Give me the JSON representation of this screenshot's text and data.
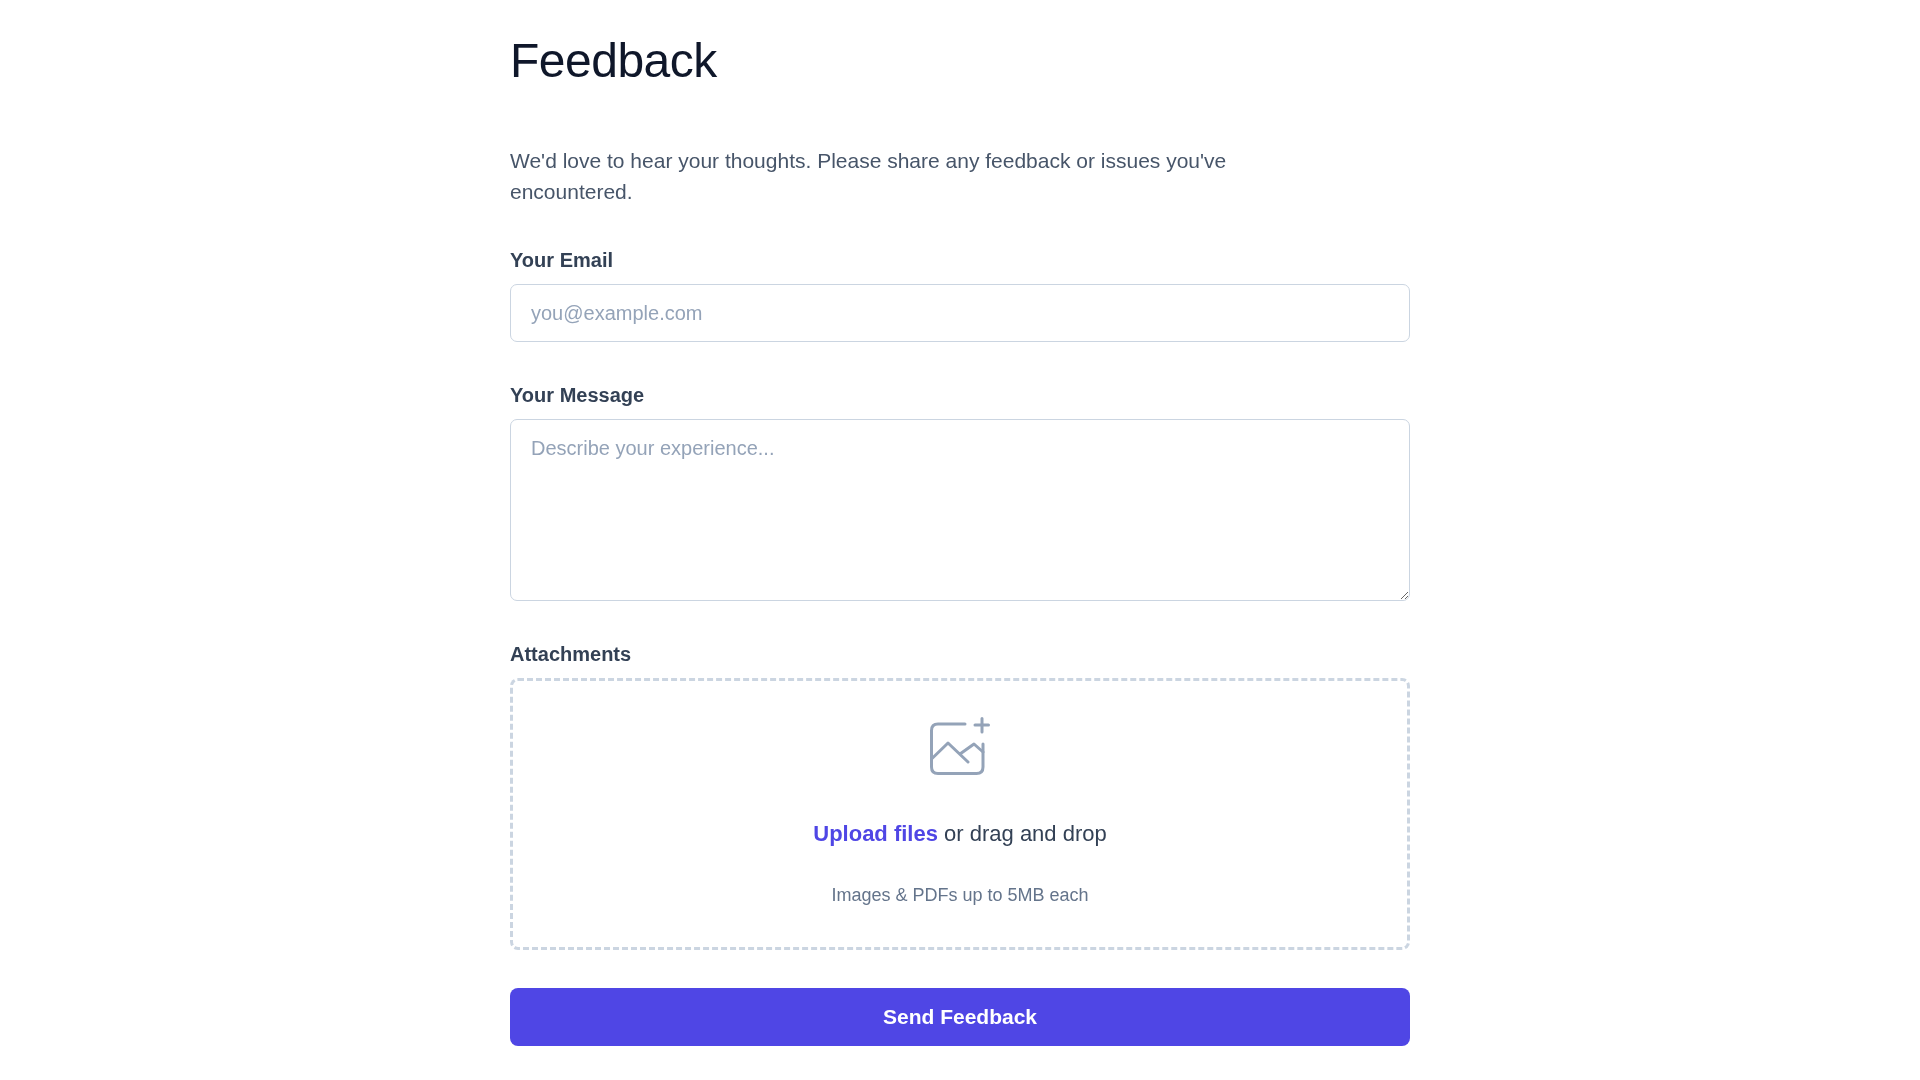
{
  "page": {
    "title": "Feedback",
    "intro": "We'd love to hear your thoughts. Please share any feedback or issues you've encountered."
  },
  "form": {
    "email": {
      "label": "Your Email",
      "placeholder": "you@example.com"
    },
    "message": {
      "label": "Your Message",
      "placeholder": "Describe your experience..."
    },
    "attachments": {
      "label": "Attachments",
      "upload_link": "Upload files",
      "drop_text": "or drag and drop",
      "hint": "Images & PDFs up to 5MB each"
    },
    "submit_button": "Send Feedback"
  }
}
